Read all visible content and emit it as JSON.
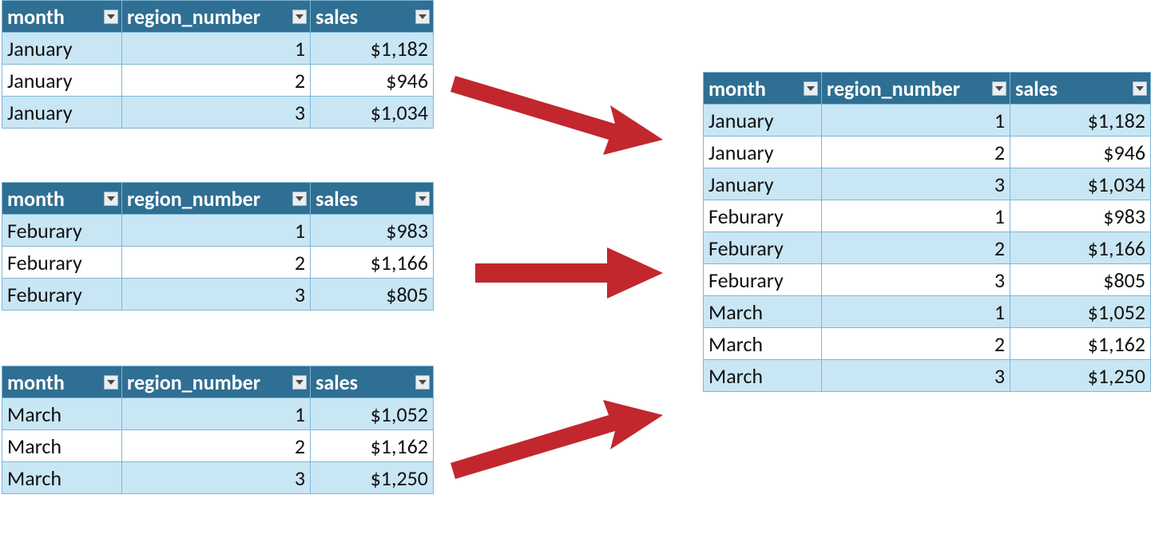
{
  "headers": {
    "month": "month",
    "region": "region_number",
    "sales": "sales",
    "filter_icon_name": "filter-dropdown-icon"
  },
  "source_tables": [
    {
      "id": "src-jan",
      "rows": [
        {
          "month": "January",
          "region": "1",
          "sales": "$1,182",
          "band": true
        },
        {
          "month": "January",
          "region": "2",
          "sales": "$946",
          "band": false
        },
        {
          "month": "January",
          "region": "3",
          "sales": "$1,034",
          "band": true
        }
      ]
    },
    {
      "id": "src-feb",
      "rows": [
        {
          "month": "Feburary",
          "region": "1",
          "sales": "$983",
          "band": true
        },
        {
          "month": "Feburary",
          "region": "2",
          "sales": "$1,166",
          "band": false
        },
        {
          "month": "Feburary",
          "region": "3",
          "sales": "$805",
          "band": true
        }
      ]
    },
    {
      "id": "src-mar",
      "rows": [
        {
          "month": "March",
          "region": "1",
          "sales": "$1,052",
          "band": true
        },
        {
          "month": "March",
          "region": "2",
          "sales": "$1,162",
          "band": false
        },
        {
          "month": "March",
          "region": "3",
          "sales": "$1,250",
          "band": true
        }
      ]
    }
  ],
  "result_table": {
    "id": "result",
    "rows": [
      {
        "month": "January",
        "region": "1",
        "sales": "$1,182",
        "band": true
      },
      {
        "month": "January",
        "region": "2",
        "sales": "$946",
        "band": false
      },
      {
        "month": "January",
        "region": "3",
        "sales": "$1,034",
        "band": true
      },
      {
        "month": "Feburary",
        "region": "1",
        "sales": "$983",
        "band": false
      },
      {
        "month": "Feburary",
        "region": "2",
        "sales": "$1,166",
        "band": true
      },
      {
        "month": "Feburary",
        "region": "3",
        "sales": "$805",
        "band": false
      },
      {
        "month": "March",
        "region": "1",
        "sales": "$1,052",
        "band": true
      },
      {
        "month": "March",
        "region": "2",
        "sales": "$1,162",
        "band": false
      },
      {
        "month": "March",
        "region": "3",
        "sales": "$1,250",
        "band": true
      }
    ]
  },
  "colors": {
    "header_bg": "#2f6f93",
    "band_bg": "#c9e6f5",
    "arrow": "#c1272d"
  }
}
